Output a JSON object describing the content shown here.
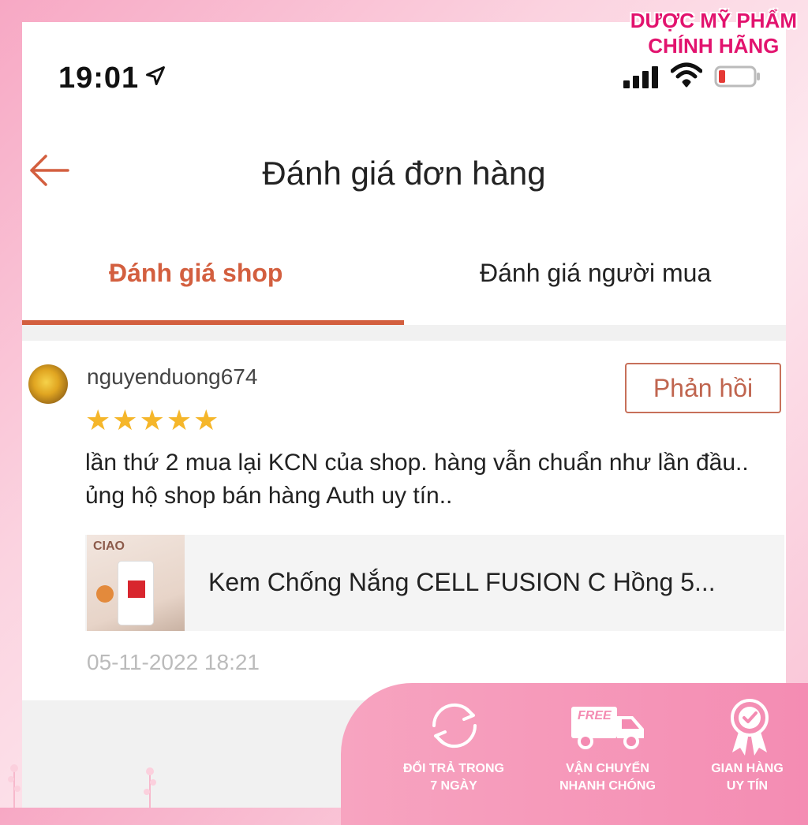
{
  "status_bar": {
    "time": "19:01"
  },
  "header": {
    "title": "Đánh giá đơn hàng"
  },
  "tabs": [
    {
      "label": "Đánh giá shop",
      "active": true
    },
    {
      "label": "Đánh giá người mua",
      "active": false
    }
  ],
  "review": {
    "username": "nguyenduong674",
    "rating": 5,
    "stars": "★★★★★",
    "reply_label": "Phản hồi",
    "text": "lần thứ 2 mua lại KCN của shop. hàng vẫn chuẩn như lần đầu.. ủng hộ shop bán hàng Auth uy tín..",
    "product_name": "Kem Chống Nắng CELL FUSION C Hồng 5...",
    "product_thumb_brand": "CIAO",
    "timestamp": "05-11-2022 18:21"
  },
  "watermark": {
    "line1": "DƯỢC MỸ PHẨM",
    "line2": "CHÍNH HÃNG"
  },
  "promo": {
    "free_text": "FREE",
    "items": [
      {
        "line1": "ĐỔI TRẢ TRONG",
        "line2": "7 NGÀY",
        "icon": "return-cycle-icon"
      },
      {
        "line1": "VẬN CHUYỂN",
        "line2": "NHANH CHÓNG",
        "icon": "delivery-truck-icon"
      },
      {
        "line1": "GIAN HÀNG",
        "line2": "UY TÍN",
        "icon": "trust-badge-icon"
      }
    ]
  },
  "colors": {
    "accent": "#d35f3f",
    "star": "#f5b62a",
    "watermark": "#e2136e",
    "promo": "#f48bb2"
  }
}
